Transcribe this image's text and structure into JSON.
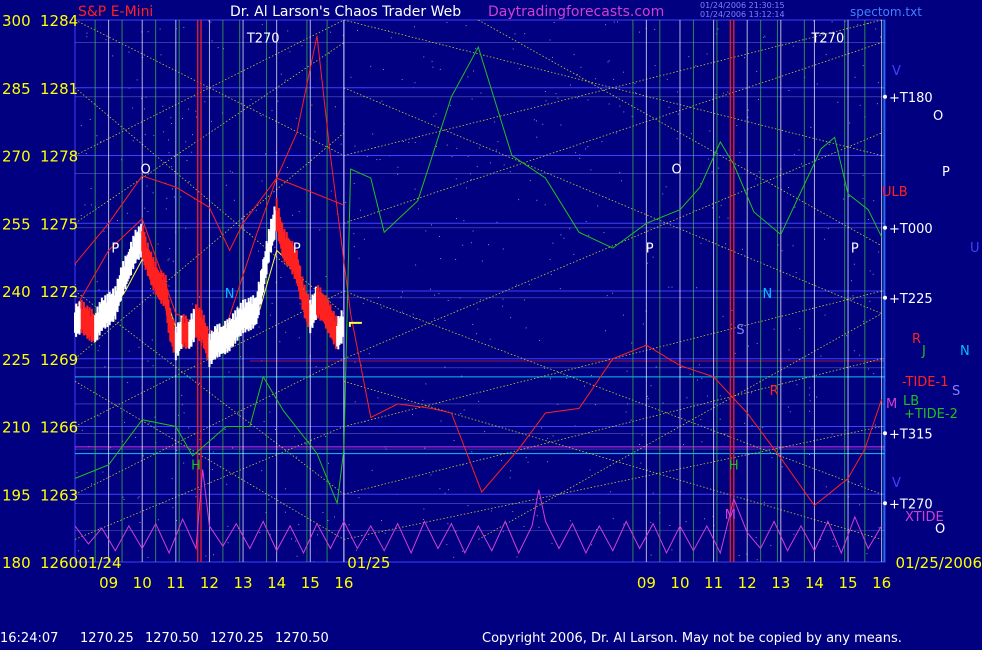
{
  "header": {
    "left_label": "S&P E-Mini",
    "title": "Dr. Al Larson's Chaos Trader Web",
    "site": "Daytradingforecasts.com",
    "stamp_line_1": "01/24/2006 21:30:15",
    "stamp_line_2": "01/24/2006 13:12:14",
    "filename": "spectom.txt"
  },
  "status": {
    "time": "16:24:07",
    "open": "1270.25",
    "high": "1270.50",
    "low": "1270.25",
    "close": "1270.50",
    "copyright": "Copyright 2006, Dr. Al Larson. May not be copied by any means."
  },
  "colors": {
    "background": "#000080",
    "price_up": "#ffffff",
    "price_down": "#ff2020",
    "ema": "#ffff40",
    "envelope": "#ff2020",
    "tide_green": "#20c020",
    "xtide": "#d040d0",
    "grid_yellow": "#e0e020",
    "vline_white": "#ffffff",
    "vline_green": "#40c040",
    "vline_red": "#ff2020"
  },
  "chart_data": {
    "type": "line",
    "title": "S&P E-Mini",
    "left_axis_labels": [
      "300",
      "285",
      "270",
      "255",
      "240",
      "225",
      "210",
      "195",
      "180"
    ],
    "price_axis_labels": [
      "1284",
      "1281",
      "1278",
      "1275",
      "1272",
      "1269",
      "1266",
      "1263",
      "1260"
    ],
    "date_labels": [
      "01/24",
      "01/25",
      "01/25/2006"
    ],
    "hour_labels": [
      "09",
      "10",
      "11",
      "12",
      "13",
      "14",
      "15",
      "16",
      "09",
      "10",
      "11",
      "12",
      "13",
      "14",
      "15",
      "16"
    ],
    "right_level_labels": [
      {
        "label": "T180",
        "price": 1280.6
      },
      {
        "label": "T000",
        "price": 1274.8
      },
      {
        "label": "T225",
        "price": 1271.7
      },
      {
        "label": "T315",
        "price": 1265.7
      },
      {
        "label": "T270",
        "price": 1262.6
      }
    ],
    "right_series_labels": [
      {
        "label": "ULB",
        "color": "#ff2020"
      },
      {
        "label": "R",
        "color": "#ff2020"
      },
      {
        "label": "J",
        "color": "#20c020"
      },
      {
        "label": "N",
        "color": "#00c0ff"
      },
      {
        "label": "-TIDE-1",
        "color": "#ff2020"
      },
      {
        "label": "S",
        "color": "#8080ff"
      },
      {
        "label": "M",
        "color": "#d040d0"
      },
      {
        "label": "LB",
        "color": "#20c020"
      },
      {
        "label": "+TIDE-2",
        "color": "#20c020"
      },
      {
        "label": "V",
        "color": "#4040ff"
      },
      {
        "label": "XTIDE",
        "color": "#d040d0"
      },
      {
        "label": "O",
        "color": "#ffffff"
      }
    ],
    "chart_annotations": [
      {
        "label": "T270",
        "hour": 13.6,
        "price": 1283.0,
        "color": "#ffffff"
      },
      {
        "label": "T270",
        "hour": 30.4,
        "price": 1283.0,
        "color": "#ffffff"
      },
      {
        "label": "O",
        "hour": 10.1,
        "price": 1277.2,
        "color": "#ffffff"
      },
      {
        "label": "P",
        "hour": 9.2,
        "price": 1273.7,
        "color": "#ffffff"
      },
      {
        "label": "N",
        "hour": 12.6,
        "price": 1271.7,
        "color": "#00c0ff"
      },
      {
        "label": "H",
        "hour": 11.6,
        "price": 1264.1,
        "color": "#20c020"
      },
      {
        "label": "P",
        "hour": 14.6,
        "price": 1273.7,
        "color": "#ffffff"
      },
      {
        "label": "O",
        "hour": 25.9,
        "price": 1277.2,
        "color": "#ffffff"
      },
      {
        "label": "P",
        "hour": 25.1,
        "price": 1273.7,
        "color": "#ffffff"
      },
      {
        "label": "N",
        "hour": 28.6,
        "price": 1271.7,
        "color": "#00c0ff"
      },
      {
        "label": "S",
        "hour": 27.8,
        "price": 1270.1,
        "color": "#8080ff"
      },
      {
        "label": "H",
        "hour": 27.6,
        "price": 1264.1,
        "color": "#20c020"
      },
      {
        "label": "R",
        "hour": 28.8,
        "price": 1267.4,
        "color": "#ff2020"
      },
      {
        "label": "M",
        "hour": 27.5,
        "price": 1261.9,
        "color": "#d040d0"
      },
      {
        "label": "P",
        "hour": 31.2,
        "price": 1273.7,
        "color": "#ffffff"
      }
    ],
    "price_axis_range": [
      1260,
      1284
    ],
    "time_axis_range": [
      8.0,
      32.1
    ],
    "x_unit": "hours since 01/24 00:00 (second day offset by 16)",
    "series": [
      {
        "name": "price",
        "points": [
          [
            8.0,
            1270.6
          ],
          [
            8.2,
            1270.8
          ],
          [
            8.4,
            1270.5
          ],
          [
            8.6,
            1270.3
          ],
          [
            8.8,
            1270.9
          ],
          [
            9.0,
            1271.1
          ],
          [
            9.2,
            1271.4
          ],
          [
            9.4,
            1272.4
          ],
          [
            9.6,
            1273.1
          ],
          [
            9.8,
            1273.9
          ],
          [
            10.0,
            1274.2
          ],
          [
            10.1,
            1273.6
          ],
          [
            10.3,
            1272.8
          ],
          [
            10.5,
            1272.2
          ],
          [
            10.7,
            1271.9
          ],
          [
            10.8,
            1270.6
          ],
          [
            11.0,
            1269.6
          ],
          [
            11.2,
            1270.2
          ],
          [
            11.4,
            1270.0
          ],
          [
            11.6,
            1270.6
          ],
          [
            11.8,
            1270.3
          ],
          [
            12.0,
            1269.3
          ],
          [
            12.2,
            1269.7
          ],
          [
            12.4,
            1269.8
          ],
          [
            12.6,
            1270.0
          ],
          [
            12.8,
            1270.4
          ],
          [
            13.0,
            1270.8
          ],
          [
            13.2,
            1270.9
          ],
          [
            13.4,
            1271.1
          ],
          [
            13.6,
            1272.6
          ],
          [
            13.8,
            1274.2
          ],
          [
            14.0,
            1275.3
          ],
          [
            14.2,
            1274.0
          ],
          [
            14.4,
            1273.6
          ],
          [
            14.6,
            1273.0
          ],
          [
            14.8,
            1271.6
          ],
          [
            15.0,
            1270.8
          ],
          [
            15.2,
            1271.5
          ],
          [
            15.4,
            1271.2
          ],
          [
            15.6,
            1270.6
          ],
          [
            15.8,
            1270.0
          ],
          [
            16.0,
            1270.5
          ]
        ],
        "color": "#ffffff"
      },
      {
        "name": "ema",
        "points": [
          [
            8.0,
            1270.3
          ],
          [
            8.5,
            1270.5
          ],
          [
            9.0,
            1270.9
          ],
          [
            9.5,
            1272.0
          ],
          [
            10.0,
            1273.4
          ],
          [
            10.5,
            1272.6
          ],
          [
            11.0,
            1270.4
          ],
          [
            11.5,
            1270.3
          ],
          [
            12.0,
            1269.8
          ],
          [
            12.5,
            1269.9
          ],
          [
            13.0,
            1270.4
          ],
          [
            13.5,
            1271.2
          ],
          [
            14.0,
            1273.8
          ],
          [
            14.5,
            1273.1
          ],
          [
            15.0,
            1271.4
          ],
          [
            15.5,
            1271.0
          ],
          [
            16.0,
            1270.2
          ]
        ],
        "color": "#ffff40"
      },
      {
        "name": "upper-envelope",
        "points": [
          [
            8.0,
            1273.2
          ],
          [
            9.0,
            1275.0
          ],
          [
            10.0,
            1277.1
          ],
          [
            11.0,
            1276.6
          ],
          [
            12.0,
            1275.7
          ],
          [
            12.6,
            1273.8
          ],
          [
            13.0,
            1275.0
          ],
          [
            14.0,
            1277.0
          ],
          [
            15.0,
            1276.4
          ],
          [
            16.0,
            1275.8
          ]
        ],
        "color": "#ff2020"
      },
      {
        "name": "red-tide",
        "points": [
          [
            8.0,
            1271.2
          ],
          [
            9.0,
            1273.8
          ],
          [
            10.0,
            1275.2
          ],
          [
            11.0,
            1271.0
          ],
          [
            11.8,
            1270.4
          ],
          [
            12.4,
            1270.0
          ],
          [
            12.8,
            1271.8
          ],
          [
            13.4,
            1274.5
          ],
          [
            14.0,
            1277.0
          ],
          [
            14.6,
            1279.0
          ],
          [
            15.2,
            1283.3
          ],
          [
            15.6,
            1278.0
          ],
          [
            16.2,
            1271.0
          ],
          [
            16.8,
            1266.4
          ],
          [
            17.6,
            1267.0
          ],
          [
            18.6,
            1266.8
          ],
          [
            19.2,
            1266.6
          ],
          [
            20.1,
            1263.1
          ],
          [
            21.2,
            1265.0
          ],
          [
            22.0,
            1266.6
          ],
          [
            23.0,
            1266.8
          ],
          [
            24.0,
            1269.0
          ],
          [
            25.0,
            1269.6
          ],
          [
            26.0,
            1268.7
          ],
          [
            27.0,
            1268.2
          ],
          [
            28.0,
            1266.6
          ],
          [
            29.0,
            1264.6
          ],
          [
            30.0,
            1262.5
          ],
          [
            31.0,
            1263.7
          ],
          [
            31.5,
            1265.0
          ],
          [
            32.0,
            1267.2
          ]
        ],
        "color": "#ff2020"
      },
      {
        "name": "green-tide",
        "points": [
          [
            8.0,
            1263.7
          ],
          [
            9.0,
            1264.3
          ],
          [
            10.0,
            1266.3
          ],
          [
            11.0,
            1266.0
          ],
          [
            11.5,
            1264.7
          ],
          [
            12.5,
            1266.0
          ],
          [
            13.2,
            1266.0
          ],
          [
            13.6,
            1268.2
          ],
          [
            14.2,
            1266.7
          ],
          [
            15.2,
            1264.8
          ],
          [
            15.8,
            1262.6
          ],
          [
            16.0,
            1265.0
          ],
          [
            16.2,
            1277.4
          ],
          [
            16.8,
            1277.0
          ],
          [
            17.2,
            1274.6
          ],
          [
            18.2,
            1276.0
          ],
          [
            19.2,
            1280.6
          ],
          [
            20.0,
            1282.8
          ],
          [
            21.0,
            1278.0
          ],
          [
            22.0,
            1277.0
          ],
          [
            23.0,
            1274.6
          ],
          [
            24.0,
            1273.9
          ],
          [
            25.0,
            1275.0
          ],
          [
            26.0,
            1275.6
          ],
          [
            26.6,
            1276.6
          ],
          [
            27.2,
            1278.6
          ],
          [
            27.6,
            1277.6
          ],
          [
            28.2,
            1275.5
          ],
          [
            29.0,
            1274.5
          ],
          [
            29.6,
            1276.4
          ],
          [
            30.2,
            1278.3
          ],
          [
            30.6,
            1278.8
          ],
          [
            31.0,
            1276.3
          ],
          [
            31.6,
            1275.6
          ],
          [
            32.0,
            1274.4
          ]
        ],
        "color": "#20c020"
      },
      {
        "name": "xtide",
        "points": [
          [
            8.0,
            1261.6
          ],
          [
            8.4,
            1260.8
          ],
          [
            8.8,
            1261.5
          ],
          [
            9.2,
            1260.5
          ],
          [
            9.6,
            1261.6
          ],
          [
            10.0,
            1260.6
          ],
          [
            10.4,
            1261.7
          ],
          [
            10.8,
            1260.4
          ],
          [
            11.2,
            1261.9
          ],
          [
            11.6,
            1260.6
          ],
          [
            11.8,
            1264.1
          ],
          [
            12.0,
            1261.6
          ],
          [
            12.4,
            1260.7
          ],
          [
            12.8,
            1261.7
          ],
          [
            13.2,
            1260.6
          ],
          [
            13.6,
            1261.8
          ],
          [
            14.0,
            1260.5
          ],
          [
            14.4,
            1261.6
          ],
          [
            14.8,
            1260.4
          ],
          [
            15.2,
            1261.7
          ],
          [
            15.6,
            1260.6
          ],
          [
            16.0,
            1261.8
          ],
          [
            16.4,
            1260.6
          ],
          [
            16.8,
            1261.6
          ],
          [
            17.2,
            1260.5
          ],
          [
            17.6,
            1261.7
          ],
          [
            18.0,
            1260.4
          ],
          [
            18.4,
            1261.8
          ],
          [
            18.8,
            1260.6
          ],
          [
            19.2,
            1261.7
          ],
          [
            19.6,
            1260.4
          ],
          [
            20.0,
            1261.6
          ],
          [
            20.4,
            1260.5
          ],
          [
            20.8,
            1261.8
          ],
          [
            21.2,
            1260.4
          ],
          [
            21.6,
            1261.6
          ],
          [
            21.8,
            1263.2
          ],
          [
            22.0,
            1261.8
          ],
          [
            22.4,
            1260.6
          ],
          [
            22.8,
            1261.7
          ],
          [
            23.2,
            1260.4
          ],
          [
            23.6,
            1261.6
          ],
          [
            24.0,
            1260.5
          ],
          [
            24.4,
            1261.8
          ],
          [
            24.8,
            1260.6
          ],
          [
            25.2,
            1261.7
          ],
          [
            25.6,
            1260.4
          ],
          [
            26.0,
            1261.6
          ],
          [
            26.4,
            1260.5
          ],
          [
            26.8,
            1261.6
          ],
          [
            27.2,
            1260.4
          ],
          [
            27.6,
            1262.8
          ],
          [
            28.0,
            1261.3
          ],
          [
            28.4,
            1260.6
          ],
          [
            28.8,
            1261.8
          ],
          [
            29.2,
            1260.5
          ],
          [
            29.6,
            1261.6
          ],
          [
            30.0,
            1260.5
          ],
          [
            30.4,
            1261.8
          ],
          [
            30.8,
            1260.4
          ],
          [
            31.2,
            1262.0
          ],
          [
            31.6,
            1260.6
          ],
          [
            32.0,
            1261.6
          ]
        ],
        "color": "#d040d0"
      }
    ]
  }
}
